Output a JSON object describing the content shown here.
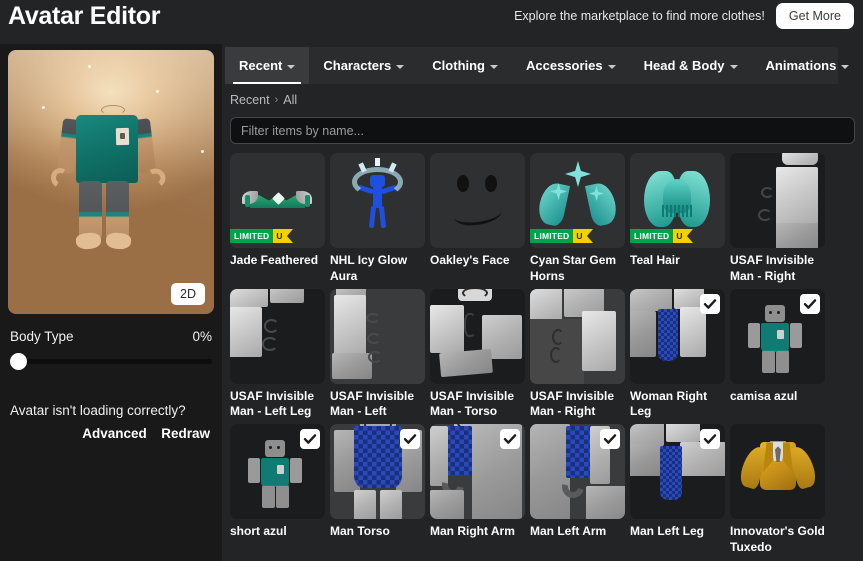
{
  "header": {
    "title": "Avatar Editor",
    "promo_text": "Explore the marketplace to find more clothes!",
    "get_more_label": "Get More"
  },
  "left_panel": {
    "toggle_view_label": "2D",
    "body_type_label": "Body Type",
    "body_type_value": "0%",
    "body_type_percent": 0,
    "loading_note": "Avatar isn't loading correctly?",
    "advanced_label": "Advanced",
    "redraw_label": "Redraw"
  },
  "tabs": [
    {
      "label": "Recent",
      "active": true
    },
    {
      "label": "Characters",
      "active": false
    },
    {
      "label": "Clothing",
      "active": false
    },
    {
      "label": "Accessories",
      "active": false
    },
    {
      "label": "Head & Body",
      "active": false
    },
    {
      "label": "Animations",
      "active": false
    }
  ],
  "breadcrumb": {
    "root": "Recent",
    "separator": "›",
    "current": "All"
  },
  "filter": {
    "placeholder": "Filter items by name...",
    "value": ""
  },
  "badges": {
    "limited_text": "LIMITED",
    "limited_u": "U"
  },
  "items": [
    {
      "name": "Jade Feathered",
      "limited": true,
      "checked": false,
      "art": "crown"
    },
    {
      "name": "NHL Icy Glow Aura",
      "limited": false,
      "checked": false,
      "art": "aura"
    },
    {
      "name": "Oakley's Face",
      "limited": false,
      "checked": false,
      "art": "face"
    },
    {
      "name": "Cyan Star Gem Horns",
      "limited": true,
      "checked": false,
      "art": "horns"
    },
    {
      "name": "Teal Hair",
      "limited": true,
      "checked": false,
      "art": "hair"
    },
    {
      "name": "USAF Invisible Man - Right",
      "limited": false,
      "checked": false,
      "art": "part-a"
    },
    {
      "name": "USAF Invisible Man - Left Leg",
      "limited": false,
      "checked": false,
      "art": "part-b"
    },
    {
      "name": "USAF Invisible Man - Left",
      "limited": false,
      "checked": false,
      "art": "part-c"
    },
    {
      "name": "USAF Invisible Man - Torso",
      "limited": false,
      "checked": false,
      "art": "part-d"
    },
    {
      "name": "USAF Invisible Man - Right",
      "limited": false,
      "checked": false,
      "art": "part-e"
    },
    {
      "name": "Woman Right Leg",
      "limited": false,
      "checked": true,
      "art": "leg-fabric"
    },
    {
      "name": "camisa azul",
      "limited": false,
      "checked": true,
      "art": "mini-teal"
    },
    {
      "name": "short azul",
      "limited": false,
      "checked": true,
      "art": "mini-teal"
    },
    {
      "name": "Man Torso",
      "limited": false,
      "checked": true,
      "art": "torso-fabric"
    },
    {
      "name": "Man Right Arm",
      "limited": false,
      "checked": true,
      "art": "arm-fabric"
    },
    {
      "name": "Man Left Arm",
      "limited": false,
      "checked": true,
      "art": "arm-fabric2"
    },
    {
      "name": "Man Left Leg",
      "limited": false,
      "checked": true,
      "art": "leg-fabric2"
    },
    {
      "name": "Innovator's Gold Tuxedo",
      "limited": false,
      "checked": false,
      "art": "tuxedo"
    }
  ],
  "colors": {
    "page_background": "#232425",
    "left_background": "#191919",
    "tabbar": "#2b2c2e",
    "tab_active": "#393b3d",
    "card": "#2f3031",
    "accent_limited_green": "#00a24a",
    "accent_limited_yellow": "#f5d000",
    "avatar_shirt_teal": "#0f7b72",
    "fabric_blue": "#2b49b8",
    "tuxedo_gold": "#d4a017"
  }
}
